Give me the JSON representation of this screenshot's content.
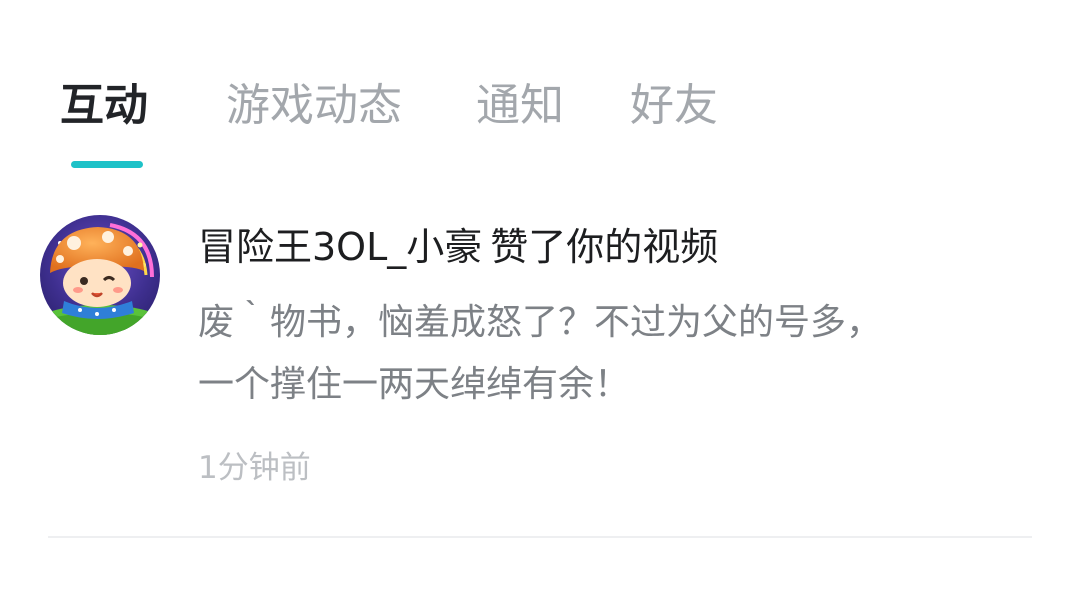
{
  "tabs": [
    {
      "label": "互动",
      "active": true
    },
    {
      "label": "游戏动态",
      "active": false
    },
    {
      "label": "通知",
      "active": false
    },
    {
      "label": "好友",
      "active": false
    }
  ],
  "accent_color": "#1ec2c8",
  "notification": {
    "avatar_icon": "mushroom-avatar-icon",
    "username": "冒险王3OL_小豪",
    "action": "赞了你的视频",
    "body_lines": [
      "废｀物书，恼羞成怒了？不过为父的号多，",
      "一个撑住一两天绰绰有余！"
    ],
    "time": "1分钟前"
  }
}
